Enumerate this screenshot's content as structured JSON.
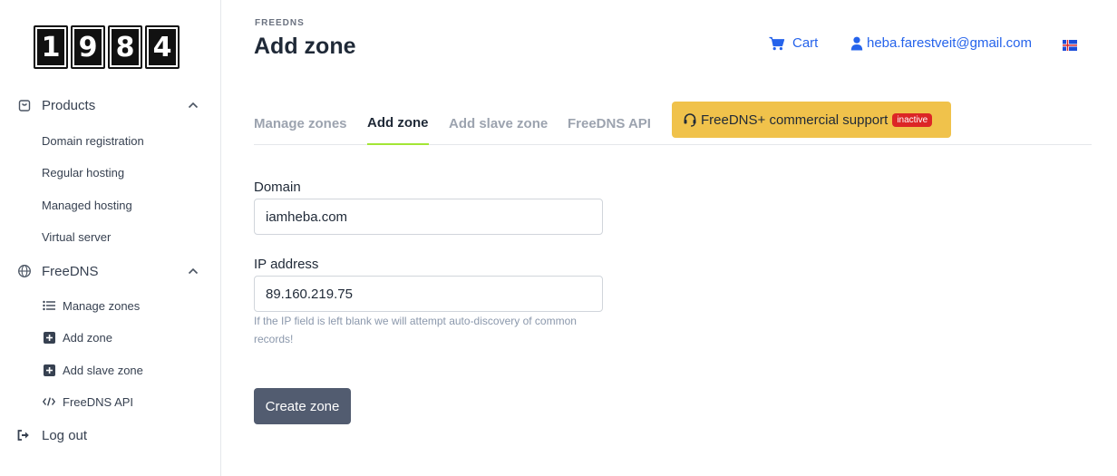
{
  "logo": {
    "digits": [
      "1",
      "9",
      "8",
      "4"
    ]
  },
  "sidebar": {
    "products": {
      "label": "Products",
      "items": [
        "Domain registration",
        "Regular hosting",
        "Managed hosting",
        "Virtual server"
      ]
    },
    "freedns": {
      "label": "FreeDNS",
      "items": [
        "Manage zones",
        "Add zone",
        "Add slave zone",
        "FreeDNS API"
      ]
    },
    "logout_label": "Log out"
  },
  "header": {
    "eyebrow": "FREEDNS",
    "title": "Add zone",
    "cart_label": "Cart",
    "user_email": "heba.farestveit@gmail.com",
    "language": "Icelandic"
  },
  "tabs": {
    "manage_zones": "Manage zones",
    "add_zone": "Add zone",
    "add_slave_zone": "Add slave zone",
    "freedns_api": "FreeDNS API",
    "support": "FreeDNS+ commercial support",
    "support_badge": "inactive",
    "active": "Add zone"
  },
  "form": {
    "domain_label": "Domain",
    "domain_value": "iamheba.com",
    "ip_label": "IP address",
    "ip_value": "89.160.219.75",
    "ip_help": "If the IP field is left blank we will attempt auto-discovery of common records!",
    "submit_label": "Create zone"
  },
  "colors": {
    "accent_link": "#2563eb",
    "support_bg": "#f0c24b",
    "badge_bg": "#dc2626",
    "button_bg": "#525c70",
    "active_tab_underline": "#a3e635"
  }
}
